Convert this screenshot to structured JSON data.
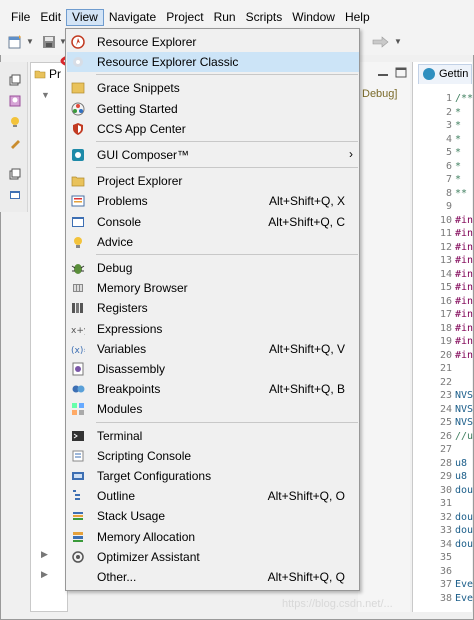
{
  "menubar": {
    "items": [
      "File",
      "Edit",
      "View",
      "Navigate",
      "Project",
      "Run",
      "Scripts",
      "Window",
      "Help"
    ],
    "active": "View"
  },
  "project_explorer": {
    "tab_label": "Pr"
  },
  "background": {
    "debug_label": "Debug]",
    "editor_tab": "Gettin",
    "line_numbers": [
      "1",
      "2",
      "3",
      "4",
      "5",
      "6",
      "7",
      "8",
      "9",
      "10",
      "11",
      "12",
      "13",
      "14",
      "15",
      "16",
      "17",
      "18",
      "19",
      "20",
      "21",
      "22",
      "23",
      "24",
      "25",
      "26",
      "27",
      "28",
      "29",
      "30",
      "31",
      "32",
      "33",
      "34",
      "35",
      "36",
      "37",
      "38"
    ],
    "code_lines": [
      "/**",
      " *",
      " *",
      " *",
      " *",
      " *",
      " *",
      " **",
      "",
      "#in",
      "#in",
      "#in",
      "#in",
      "#in",
      "#in",
      "#in",
      "#in",
      "#in",
      "#in",
      "#in",
      "",
      "",
      "NVS",
      "NVS",
      "NVS",
      "//u",
      "",
      "u8",
      "u8",
      "dou",
      "",
      "dou",
      "dou",
      "dou",
      "",
      "",
      "Eve",
      "Eve"
    ]
  },
  "view_menu": {
    "items": [
      {
        "label": "Resource Explorer",
        "shortcut": "",
        "icon": "compass-icon"
      },
      {
        "label": "Resource Explorer Classic",
        "shortcut": "",
        "icon": "gear-icon",
        "selected": true
      },
      {
        "separator": true
      },
      {
        "label": "Grace Snippets",
        "shortcut": "",
        "icon": "snippet-icon"
      },
      {
        "label": "Getting Started",
        "shortcut": "",
        "icon": "globe-icon"
      },
      {
        "label": "CCS App Center",
        "shortcut": "",
        "icon": "shield-icon"
      },
      {
        "separator": true
      },
      {
        "label": "GUI Composer™",
        "shortcut": "",
        "icon": "composer-icon",
        "submenu": true
      },
      {
        "separator": true
      },
      {
        "label": "Project Explorer",
        "shortcut": "",
        "icon": "folder-icon"
      },
      {
        "label": "Problems",
        "shortcut": "Alt+Shift+Q, X",
        "icon": "problems-icon"
      },
      {
        "label": "Console",
        "shortcut": "Alt+Shift+Q, C",
        "icon": "console-icon"
      },
      {
        "label": "Advice",
        "shortcut": "",
        "icon": "lightbulb-icon"
      },
      {
        "separator": true
      },
      {
        "label": "Debug",
        "shortcut": "",
        "icon": "bug-icon"
      },
      {
        "label": "Memory Browser",
        "shortcut": "",
        "icon": "memory-icon"
      },
      {
        "label": "Registers",
        "shortcut": "",
        "icon": "registers-icon"
      },
      {
        "label": "Expressions",
        "shortcut": "",
        "icon": "expressions-icon"
      },
      {
        "label": "Variables",
        "shortcut": "Alt+Shift+Q, V",
        "icon": "variables-icon"
      },
      {
        "label": "Disassembly",
        "shortcut": "",
        "icon": "disassembly-icon"
      },
      {
        "label": "Breakpoints",
        "shortcut": "Alt+Shift+Q, B",
        "icon": "breakpoints-icon"
      },
      {
        "label": "Modules",
        "shortcut": "",
        "icon": "modules-icon"
      },
      {
        "separator": true
      },
      {
        "label": "Terminal",
        "shortcut": "",
        "icon": "terminal-icon"
      },
      {
        "label": "Scripting Console",
        "shortcut": "",
        "icon": "scripting-icon"
      },
      {
        "label": "Target Configurations",
        "shortcut": "",
        "icon": "target-icon"
      },
      {
        "label": "Outline",
        "shortcut": "Alt+Shift+Q, O",
        "icon": "outline-icon"
      },
      {
        "label": "Stack Usage",
        "shortcut": "",
        "icon": "stack-icon"
      },
      {
        "label": "Memory Allocation",
        "shortcut": "",
        "icon": "allocation-icon"
      },
      {
        "label": "Optimizer Assistant",
        "shortcut": "",
        "icon": "optimizer-icon"
      },
      {
        "label": "Other...",
        "shortcut": "Alt+Shift+Q, Q",
        "icon": ""
      }
    ]
  },
  "colors": {
    "menu_bg": "#f0f0f0",
    "selected_bg": "#cce4f7",
    "annotation": "#d9262b"
  },
  "watermark": "https://blog.csdn.net/..."
}
